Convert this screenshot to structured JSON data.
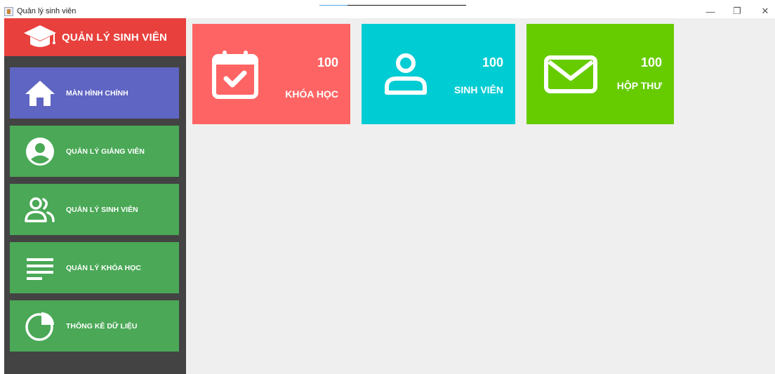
{
  "window": {
    "title": "Quản lý sinh viên",
    "controls": {
      "minimize": "—",
      "restore": "❐",
      "close": "✕"
    }
  },
  "colors": {
    "brand": "#e8403c",
    "sidebar_bg": "#434343",
    "nav_active": "#5f65c2",
    "nav_normal": "#4aa856",
    "card_courses": "#ff6464",
    "card_students": "#00ccd3",
    "card_mail": "#66cc00",
    "main_bg": "#efefef"
  },
  "sidebar": {
    "brand": {
      "title": "QUẢN LÝ SINH VIÊN",
      "icon": "graduation-cap-icon"
    },
    "items": [
      {
        "label": "MÀN HÌNH CHÍNH",
        "icon": "home-icon",
        "active": true
      },
      {
        "label": "QUẢN LÝ GIẢNG VIÊN",
        "icon": "user-circle-icon",
        "active": false
      },
      {
        "label": "QUẢN LÝ SINH VIÊN",
        "icon": "users-icon",
        "active": false
      },
      {
        "label": "QUẢN LÝ KHÓA HỌC",
        "icon": "list-icon",
        "active": false
      },
      {
        "label": "THÔNG KÊ DỮ LIỆU",
        "icon": "pie-chart-icon",
        "active": false
      }
    ]
  },
  "dashboard": {
    "cards": [
      {
        "count": "100",
        "label": "KHÓA HỌC",
        "icon": "calendar-check-icon"
      },
      {
        "count": "100",
        "label": "SINH VIÊN",
        "icon": "user-icon"
      },
      {
        "count": "100",
        "label": "HỘP THƯ",
        "icon": "mail-icon"
      }
    ]
  }
}
